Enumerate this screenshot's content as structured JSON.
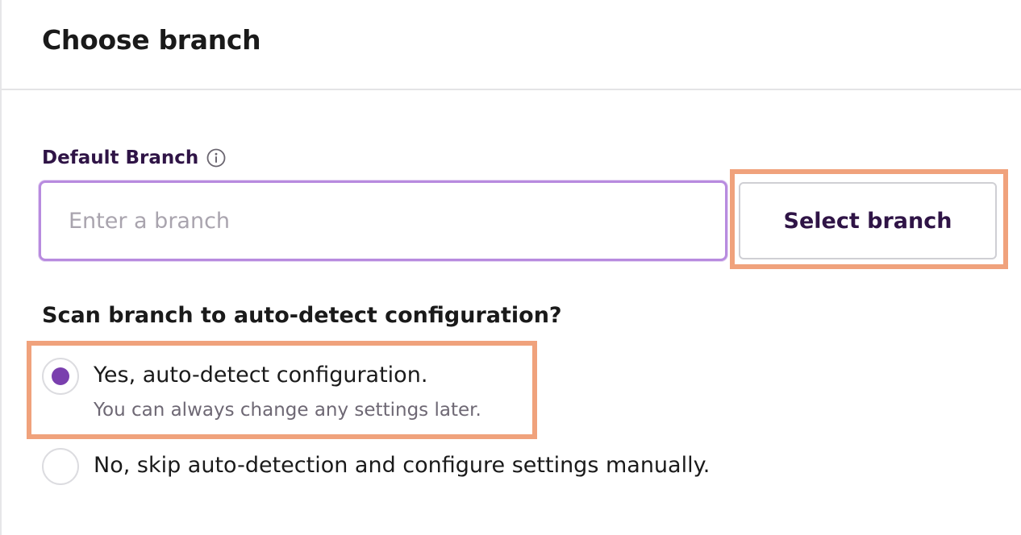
{
  "header": {
    "title": "Choose branch"
  },
  "branch_field": {
    "label": "Default Branch",
    "placeholder": "Enter a branch",
    "value": "",
    "info_icon": "info-circle-icon"
  },
  "select_button": {
    "label": "Select branch"
  },
  "scan_question": {
    "label": "Scan branch to auto-detect configuration?",
    "options": [
      {
        "label": "Yes, auto-detect configuration.",
        "sublabel": "You can always change any settings later.",
        "selected": true
      },
      {
        "label": "No, skip auto-detection and configure settings manually.",
        "selected": false
      }
    ]
  },
  "colors": {
    "accent": "#7a3fae",
    "focus_border": "#b88bdf",
    "highlight": "#f0a27c",
    "label_text": "#2f1446"
  }
}
